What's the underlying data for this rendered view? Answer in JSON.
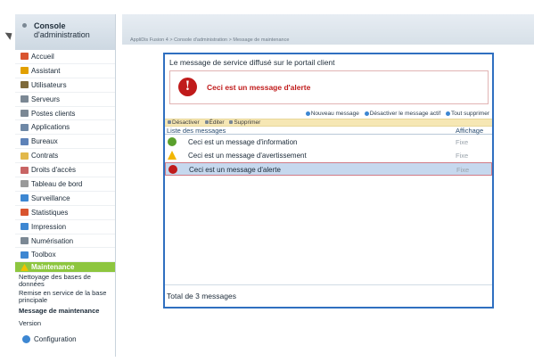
{
  "sidebar": {
    "title": "Console",
    "subtitle": "d'administration",
    "items": [
      {
        "label": "Accueil",
        "icon": "home-icon",
        "color": "#d9542f"
      },
      {
        "label": "Assistant",
        "icon": "wand-icon",
        "color": "#e2a000"
      },
      {
        "label": "Utilisateurs",
        "icon": "users-icon",
        "color": "#7e6a3a"
      },
      {
        "label": "Serveurs",
        "icon": "servers-icon",
        "color": "#7b8894"
      },
      {
        "label": "Postes clients",
        "icon": "clients-icon",
        "color": "#7b8894"
      },
      {
        "label": "Applications",
        "icon": "applications-icon",
        "color": "#6e88a6"
      },
      {
        "label": "Bureaux",
        "icon": "desktops-icon",
        "color": "#5d82b8"
      },
      {
        "label": "Contrats",
        "icon": "contracts-icon",
        "color": "#e2b84a"
      },
      {
        "label": "Droits d'accès",
        "icon": "access-rights-icon",
        "color": "#c86464"
      },
      {
        "label": "Tableau de bord",
        "icon": "dashboard-icon",
        "color": "#9a9a9a"
      },
      {
        "label": "Surveillance",
        "icon": "monitoring-icon",
        "color": "#3d87d2"
      },
      {
        "label": "Statistiques",
        "icon": "statistics-icon",
        "color": "#d9542f"
      },
      {
        "label": "Impression",
        "icon": "printer-icon",
        "color": "#3d87d2"
      },
      {
        "label": "Numérisation",
        "icon": "scanner-icon",
        "color": "#7b8894"
      },
      {
        "label": "Toolbox",
        "icon": "toolbox-icon",
        "color": "#3d87d2"
      }
    ],
    "active": "Maintenance",
    "sub_items": [
      "Nettoyage des bases de données",
      "Remise en service de la base principale",
      "Message de maintenance",
      "Version"
    ],
    "config": "Configuration"
  },
  "breadcrumb": "AppliDis Fusion 4 > Console d'administration > Message de maintenance",
  "panel": {
    "title": "Le message de service diffusé sur le portail client",
    "alert_text": "Ceci est un message d'alerte",
    "toolbar": [
      "Nouveau message",
      "Désactiver le message actif",
      "Tout supprimer"
    ],
    "actions": [
      "Désactiver",
      "Éditer",
      "Supprimer"
    ],
    "list_header": "Liste des messages",
    "list_header_right": "Affichage",
    "rows": [
      {
        "text": "Ceci est un message d'information",
        "status": "Fixe",
        "type": "info"
      },
      {
        "text": "Ceci est un message d'avertissement",
        "status": "Fixe",
        "type": "warning"
      },
      {
        "text": "Ceci est un message d'alerte",
        "status": "Fixe",
        "type": "alert"
      }
    ],
    "footer": "Total de 3 messages"
  },
  "colors": {
    "accent_blue": "#2f6fc0",
    "active_green": "#8dc63f",
    "alert_red": "#c01b1b",
    "warn_yellow": "#f2b600",
    "info_green": "#5aa02c"
  }
}
